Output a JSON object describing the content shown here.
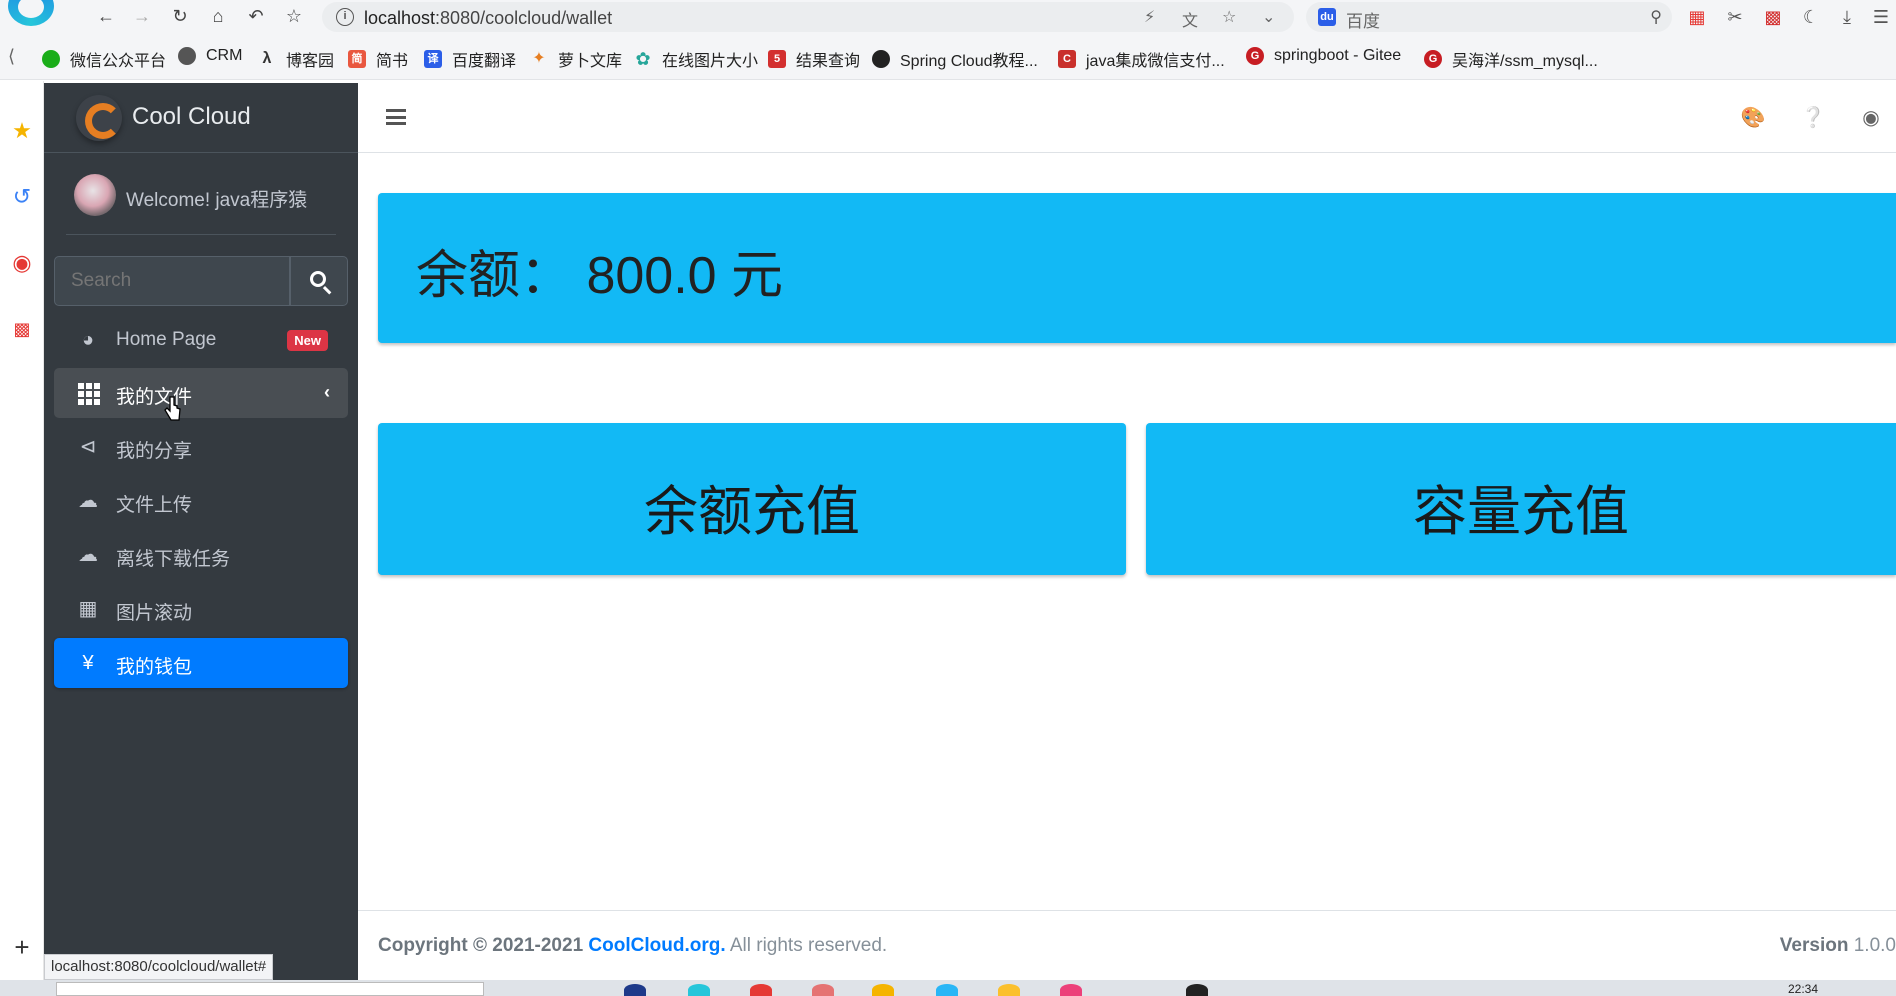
{
  "browser": {
    "url_host": "localhost",
    "url_rest": ":8080/coolcloud/wallet",
    "search_placeholder": "百度",
    "status_url": "localhost:8080/coolcloud/wallet#",
    "bookmarks": [
      {
        "label": "微信公众平台",
        "icon": "wechat-icon",
        "color": "#1aad19"
      },
      {
        "label": "CRM",
        "icon": "globe-icon",
        "color": "#555555"
      },
      {
        "label": "博客园",
        "icon": "cnblogs-icon",
        "color": "#333333"
      },
      {
        "label": "简书",
        "icon": "jianshu-icon",
        "color": "#e9573f"
      },
      {
        "label": "百度翻译",
        "icon": "baidu-translate-icon",
        "color": "#2b5ee8"
      },
      {
        "label": "萝卜文库",
        "icon": "carrot-icon",
        "color": "#e67e22"
      },
      {
        "label": "在线图片大小",
        "icon": "flower-icon",
        "color": "#26a69a"
      },
      {
        "label": "结果查询",
        "icon": "five-icon",
        "color": "#d32f2f"
      },
      {
        "label": "Spring Cloud教程...",
        "icon": "github-icon",
        "color": "#222222"
      },
      {
        "label": "java集成微信支付...",
        "icon": "csdn-icon",
        "color": "#c9302c"
      },
      {
        "label": "springboot - Gitee",
        "icon": "gitee-icon",
        "color": "#c71d23"
      },
      {
        "label": "吴海洋/ssm_mysql...",
        "icon": "gitee-icon",
        "color": "#c71d23"
      }
    ],
    "taskbar_time": "22:34"
  },
  "sidebar": {
    "brand": "Cool Cloud",
    "user": "Welcome! java程序猿",
    "search_placeholder": "Search",
    "menu": [
      {
        "label": "Home Page",
        "icon": "dashboard-icon",
        "badge": "New"
      },
      {
        "label": "我的文件",
        "icon": "grid-icon"
      },
      {
        "label": "我的分享",
        "icon": "share-icon"
      },
      {
        "label": "文件上传",
        "icon": "cloud-upload-icon"
      },
      {
        "label": "离线下载任务",
        "icon": "cloud-download-icon"
      },
      {
        "label": "图片滚动",
        "icon": "image-icon"
      },
      {
        "label": "我的钱包",
        "icon": "yen-icon"
      }
    ]
  },
  "main": {
    "balance_text": "余额：  800.0 元",
    "recharge_balance": "余额充值",
    "recharge_capacity": "容量充值"
  },
  "footer": {
    "copyright_prefix": "Copyright © 2021-2021",
    "site": "CoolCloud.org.",
    "rights": "All rights reserved.",
    "version_label": "Version",
    "version": "1.0.0"
  },
  "colors": {
    "sidebar_bg": "#343a40",
    "active_blue": "#007bff",
    "card_blue": "#12b9f5",
    "badge_red": "#dc3545"
  }
}
